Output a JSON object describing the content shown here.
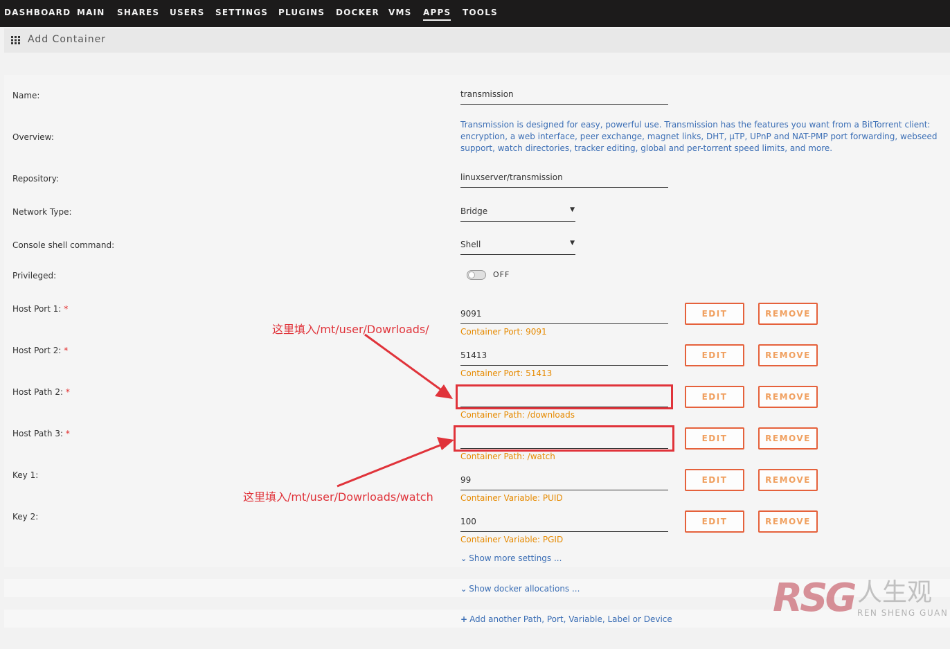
{
  "nav": {
    "items": [
      "DASHBOARD",
      "MAIN",
      "SHARES",
      "USERS",
      "SETTINGS",
      "PLUGINS",
      "DOCKER",
      "VMS",
      "APPS",
      "TOOLS"
    ],
    "active": "APPS"
  },
  "page": {
    "title": "Add Container"
  },
  "form": {
    "name": {
      "label": "Name:",
      "value": "transmission"
    },
    "overview": {
      "label": "Overview:",
      "text": "Transmission is designed for easy, powerful use. Transmission has the features you want from a BitTorrent client: encryption, a web interface, peer exchange, magnet links, DHT, µTP, UPnP and NAT-PMP port forwarding, webseed support, watch directories, tracker editing, global and per-torrent speed limits, and more."
    },
    "repository": {
      "label": "Repository:",
      "value": "linuxserver/transmission"
    },
    "network_type": {
      "label": "Network Type:",
      "value": "Bridge"
    },
    "console_shell": {
      "label": "Console shell command:",
      "value": "Shell"
    },
    "privileged": {
      "label": "Privileged:",
      "state": "OFF"
    },
    "required_mark": "*",
    "config_rows": [
      {
        "label": "Host Port 1:",
        "value": "9091",
        "hint": "Container Port: 9091"
      },
      {
        "label": "Host Port 2:",
        "value": "51413",
        "hint": "Container Port: 51413"
      },
      {
        "label": "Host Path 2:",
        "value": "",
        "hint": "Container Path: /downloads"
      },
      {
        "label": "Host Path 3:",
        "value": "",
        "hint": "Container Path: /watch"
      },
      {
        "label": "Key 1:",
        "value": "99",
        "hint": "Container Variable: PUID"
      },
      {
        "label": "Key 2:",
        "value": "100",
        "hint": "Container Variable: PGID"
      }
    ],
    "edit_label": "EDIT",
    "remove_label": "REMOVE"
  },
  "links": {
    "more_settings": "Show more settings ...",
    "docker_allocations": "Show docker allocations ...",
    "add_another": "Add another Path, Port, Variable, Label or Device"
  },
  "annotations": {
    "downloads": "这里填入/mt/user/Dowrloads/",
    "watch": "这里填入/mt/user/Dowrloads/watch",
    "color": "#e0333a"
  },
  "watermark": {
    "logo": "RSG",
    "cn": "人生观",
    "en": "REN SHENG GUAN"
  }
}
